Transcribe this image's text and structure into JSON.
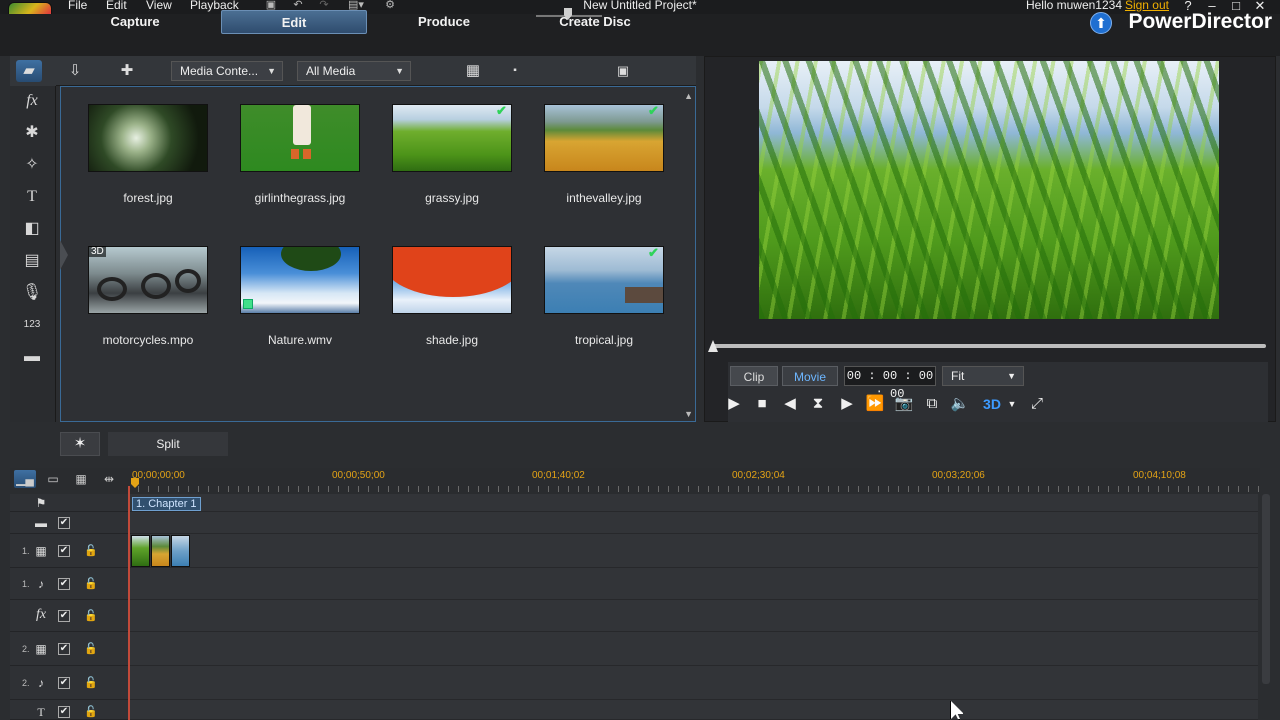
{
  "menu": {
    "items": [
      "File",
      "Edit",
      "View",
      "Playback"
    ]
  },
  "window": {
    "title": "New Untitled Project*",
    "greeting": "Hello muwen1234",
    "sign_out": "Sign out",
    "help": "?",
    "minimize": "–",
    "maximize": "□",
    "close": "✕"
  },
  "modes": {
    "capture": "Capture",
    "edit": "Edit",
    "produce": "Produce",
    "create_disc": "Create Disc",
    "brand": "PowerDirector"
  },
  "library": {
    "content_dropdown": "Media Conte...",
    "filter_dropdown": "All Media",
    "items": [
      {
        "label": "forest.jpg",
        "checked": false,
        "badge": ""
      },
      {
        "label": "girlinthegrass.jpg",
        "checked": false,
        "badge": ""
      },
      {
        "label": "grassy.jpg",
        "checked": true,
        "badge": ""
      },
      {
        "label": "inthevalley.jpg",
        "checked": true,
        "badge": ""
      },
      {
        "label": "motorcycles.mpo",
        "checked": false,
        "badge": "3D"
      },
      {
        "label": "Nature.wmv",
        "checked": false,
        "badge": ""
      },
      {
        "label": "shade.jpg",
        "checked": false,
        "badge": ""
      },
      {
        "label": "tropical.jpg",
        "checked": true,
        "badge": ""
      }
    ]
  },
  "preview": {
    "clip_label": "Clip",
    "movie_label": "Movie",
    "timecode": "00 : 00 : 00 : 00",
    "fit_label": "Fit",
    "badge_3d": "3D"
  },
  "toolbar": {
    "split_label": "Split"
  },
  "timeline": {
    "ruler_labels": [
      "00;00;00;00",
      "00;00;50;00",
      "00;01;40;02",
      "00;02;30;04",
      "00;03;20;06",
      "00;04;10;08"
    ],
    "chapter": "1. Chapter 1",
    "tracks": [
      {
        "num": "",
        "icon": "▬"
      },
      {
        "num": "1.",
        "icon": "▦"
      },
      {
        "num": "1.",
        "icon": "♪"
      },
      {
        "num": "",
        "icon": "fx"
      },
      {
        "num": "2.",
        "icon": "▦"
      },
      {
        "num": "2.",
        "icon": "♪"
      },
      {
        "num": "",
        "icon": "T"
      }
    ]
  },
  "colors": {
    "accent": "#3d9bff",
    "timecode_orange": "#e3a316",
    "check_green": "#2fd35a"
  }
}
